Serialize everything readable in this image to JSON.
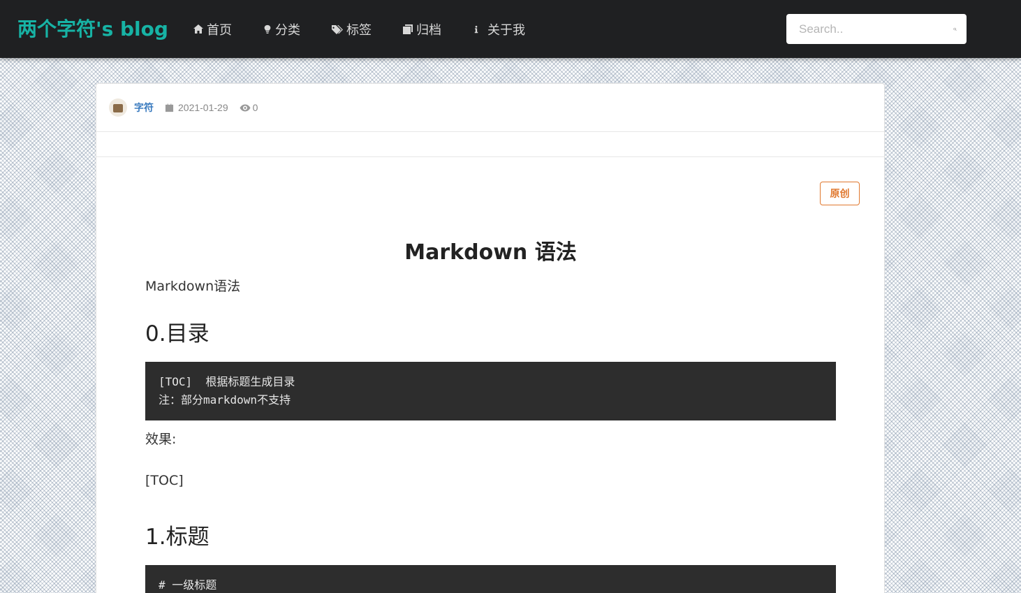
{
  "navbar": {
    "brand": "两个字符's blog",
    "items": [
      {
        "label": "首页",
        "icon": "home-icon"
      },
      {
        "label": "分类",
        "icon": "lightbulb-icon"
      },
      {
        "label": "标签",
        "icon": "tags-icon"
      },
      {
        "label": "归档",
        "icon": "archive-icon"
      },
      {
        "label": "关于我",
        "icon": "info-icon"
      }
    ],
    "search": {
      "placeholder": "Search..",
      "icon": "search-icon"
    }
  },
  "post": {
    "author": "字符",
    "date": "2021-01-29",
    "views": "0",
    "badge": "原创",
    "title": "Markdown 语法",
    "intro": "Markdown语法",
    "sections": [
      {
        "heading": "0.目录",
        "code_lines": [
          "[TOC]  根据标题生成目录",
          "注：部分markdown不支持"
        ],
        "after": [
          "效果:",
          "[TOC]"
        ]
      },
      {
        "heading": "1.标题",
        "code_lines": [
          "# 一级标题"
        ]
      }
    ]
  },
  "colors": {
    "brand": "#17b3a5",
    "navbar_bg": "#1f2022",
    "badge": "#e0782e",
    "author": "#3a7bbf",
    "code_bg": "#2d2d2d"
  }
}
